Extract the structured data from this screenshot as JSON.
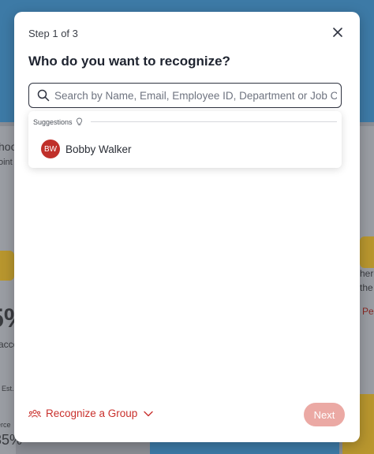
{
  "modal": {
    "step": "Step 1 of 3",
    "title": "Who do you want to recognize?",
    "search": {
      "placeholder": "Search by Name, Email, Employee ID, Department or Job C",
      "value": ""
    },
    "suggestions": {
      "label": "Suggestions",
      "people": [
        {
          "initials": "BW",
          "name": "Bobby Walker",
          "avatar_color": "#c0302a"
        }
      ]
    },
    "footer": {
      "group_label": "Recognize a Group",
      "next_label": "Next"
    }
  },
  "background": {
    "left_texts": [
      "hoo",
      "oint",
      "5%",
      "acco",
      "Est.",
      "erce",
      "35%"
    ],
    "right_texts": [
      "here",
      "the",
      "Pe"
    ]
  },
  "colors": {
    "accent": "#c9302c",
    "next_disabled": "#eba9a4",
    "title": "#1f2430"
  }
}
